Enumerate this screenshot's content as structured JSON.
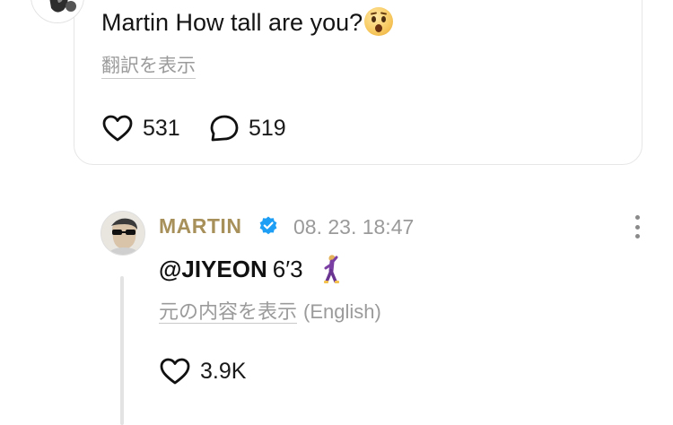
{
  "post": {
    "text": "Martin How tall are you?",
    "emoji": "astonished-face",
    "translate_label": "翻訳を表示",
    "likes": "531",
    "replies": "519"
  },
  "reply": {
    "username": "MARTIN",
    "verified": true,
    "timestamp": "08. 23. 18:47",
    "mention": "@JIYEON",
    "text": "6′3",
    "emoji": "dancing-figure",
    "show_original_label": "元の内容を表示",
    "language": "(English)",
    "likes": "3.9K"
  },
  "colors": {
    "username": "#a8905a",
    "verified_badge": "#1e9ef4",
    "muted_text": "#9b9b9b"
  }
}
